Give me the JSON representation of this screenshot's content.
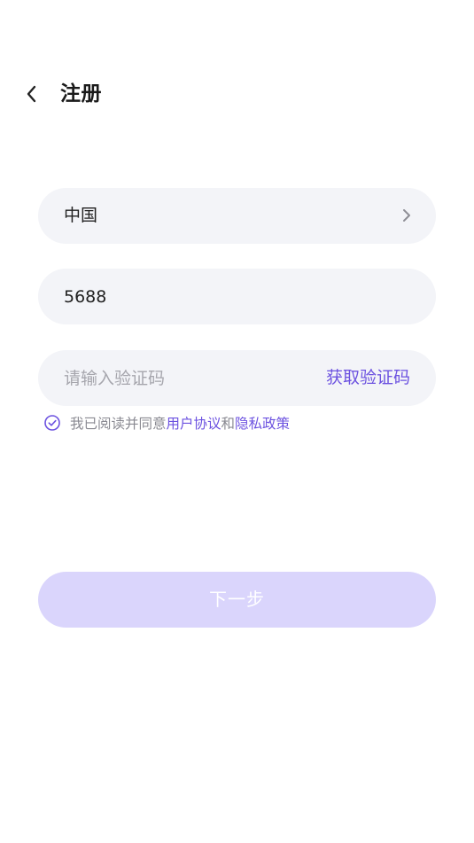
{
  "header": {
    "back_icon": "chevron-left-icon",
    "title": "注册"
  },
  "form": {
    "country": {
      "value": "中国",
      "icon": "chevron-right-icon"
    },
    "phone": {
      "value": "5688"
    },
    "code": {
      "placeholder": "请输入验证码",
      "value": "",
      "get_code_label": "获取验证码"
    }
  },
  "agreement": {
    "checkbox_icon": "check-circle-icon",
    "checked": true,
    "prefix": "我已阅读并同意",
    "user_agreement": "用户协议",
    "conjunction": "和",
    "privacy_policy": "隐私政策"
  },
  "actions": {
    "next_label": "下一步"
  },
  "colors": {
    "accent": "#6c52e0",
    "field_background": "#f3f4f8",
    "button_disabled": "#dad5fc",
    "placeholder": "#a6a6ad"
  }
}
